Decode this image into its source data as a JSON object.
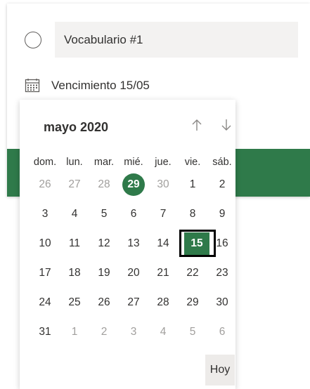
{
  "task": {
    "title_value": "Vocabulario #1",
    "due_label": "Vencimiento 15/05"
  },
  "calendar": {
    "month_label": "mayo 2020",
    "weekdays": [
      "dom.",
      "lun.",
      "mar.",
      "mié.",
      "jue.",
      "vie.",
      "sáb."
    ],
    "weeks": [
      [
        {
          "d": "26",
          "out": true
        },
        {
          "d": "27",
          "out": true
        },
        {
          "d": "28",
          "out": true
        },
        {
          "d": "29",
          "out": false,
          "today": true
        },
        {
          "d": "30",
          "out": true
        },
        {
          "d": "1",
          "out": false
        },
        {
          "d": "2",
          "out": false
        }
      ],
      [
        {
          "d": "3"
        },
        {
          "d": "4"
        },
        {
          "d": "5"
        },
        {
          "d": "6"
        },
        {
          "d": "7"
        },
        {
          "d": "8"
        },
        {
          "d": "9"
        }
      ],
      [
        {
          "d": "10"
        },
        {
          "d": "11"
        },
        {
          "d": "12"
        },
        {
          "d": "13"
        },
        {
          "d": "14"
        },
        {
          "d": "15",
          "selected": true
        },
        {
          "d": "16"
        }
      ],
      [
        {
          "d": "17"
        },
        {
          "d": "18"
        },
        {
          "d": "19"
        },
        {
          "d": "20"
        },
        {
          "d": "21"
        },
        {
          "d": "22"
        },
        {
          "d": "23"
        }
      ],
      [
        {
          "d": "24"
        },
        {
          "d": "25"
        },
        {
          "d": "26"
        },
        {
          "d": "27"
        },
        {
          "d": "28"
        },
        {
          "d": "29"
        },
        {
          "d": "30"
        }
      ],
      [
        {
          "d": "31"
        },
        {
          "d": "1",
          "out": true
        },
        {
          "d": "2",
          "out": true
        },
        {
          "d": "3",
          "out": true
        },
        {
          "d": "4",
          "out": true
        },
        {
          "d": "5",
          "out": true
        },
        {
          "d": "6",
          "out": true
        }
      ]
    ],
    "today_button": "Hoy"
  },
  "colors": {
    "accent": "#2f7a4a",
    "text": "#323130",
    "muted": "#a19f9d",
    "input_bg": "#f3f2f1"
  },
  "icons": {
    "radio": "radio-circle-icon",
    "calendar": "calendar-icon",
    "up": "arrow-up-icon",
    "down": "arrow-down-icon"
  }
}
